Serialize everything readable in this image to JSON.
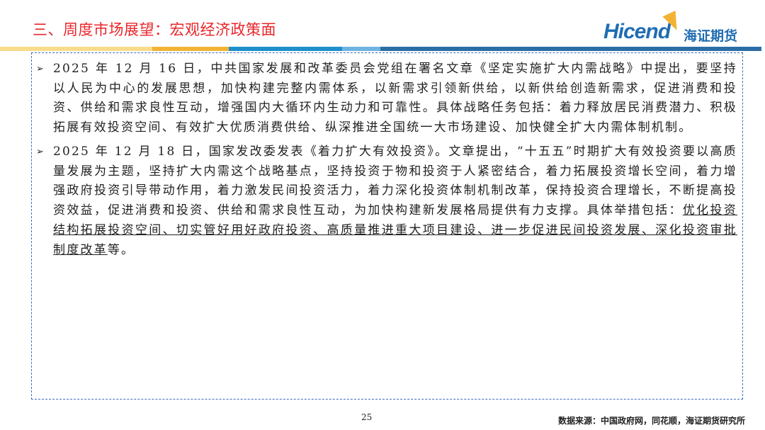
{
  "header": {
    "title": "三、周度市场展望：宏观经济政策面",
    "logo_en": "Hicend",
    "logo_cn": "海证期货"
  },
  "colors": {
    "title": "#e8262b",
    "bar": [
      "#f9dc8a",
      "#f4b234",
      "#1f8fcb",
      "#6fb3e0",
      "#2b6ea6"
    ],
    "border": "#3d6cc0"
  },
  "items": [
    {
      "bullet": "➢",
      "text": "2025 年 12 月 16 日，中共国家发展和改革委员会党组在署名文章《坚定实施扩大内需战略》中提出，要坚持以人民为中心的发展思想，加快构建完整内需体系，以新需求引领新供给，以新供给创造新需求，促进消费和投资、供给和需求良性互动，增强国内大循环内生动力和可靠性。具体战略任务包括：着力释放居民消费潜力、积极拓展有效投资空间、有效扩大优质消费供给、纵深推进全国统一大市场建设、加快健全扩大内需体制机制。"
    },
    {
      "bullet": "➢",
      "text": "2025 年 12 月 18 日，国家发改委发表《着力扩大有效投资》。文章提出，“十五五”时期扩大有效投资要以高质量发展为主题，坚持扩大内需这个战略基点，坚持投资于物和投资于人紧密结合，着力拓展投资增长空间，着力增强政府投资引导带动作用，着力激发民间投资活力，着力深化投资体制机制改革，保持投资合理增长，不断提高投资效益，促进消费和投资、供给和需求良性互动，为加快构建新发展格局提供有力支撑。具体举措包括：",
      "underlined": "优化投资结构拓展投资空间、切实管好用好政府投资、高质量推进重大项目建设、进一步促进民间投资发展、深化投资审批制度改革",
      "tail": "等。"
    }
  ],
  "footer": {
    "page": "25",
    "source": "数据来源：中国政府网，同花顺，海证期货研究所"
  }
}
